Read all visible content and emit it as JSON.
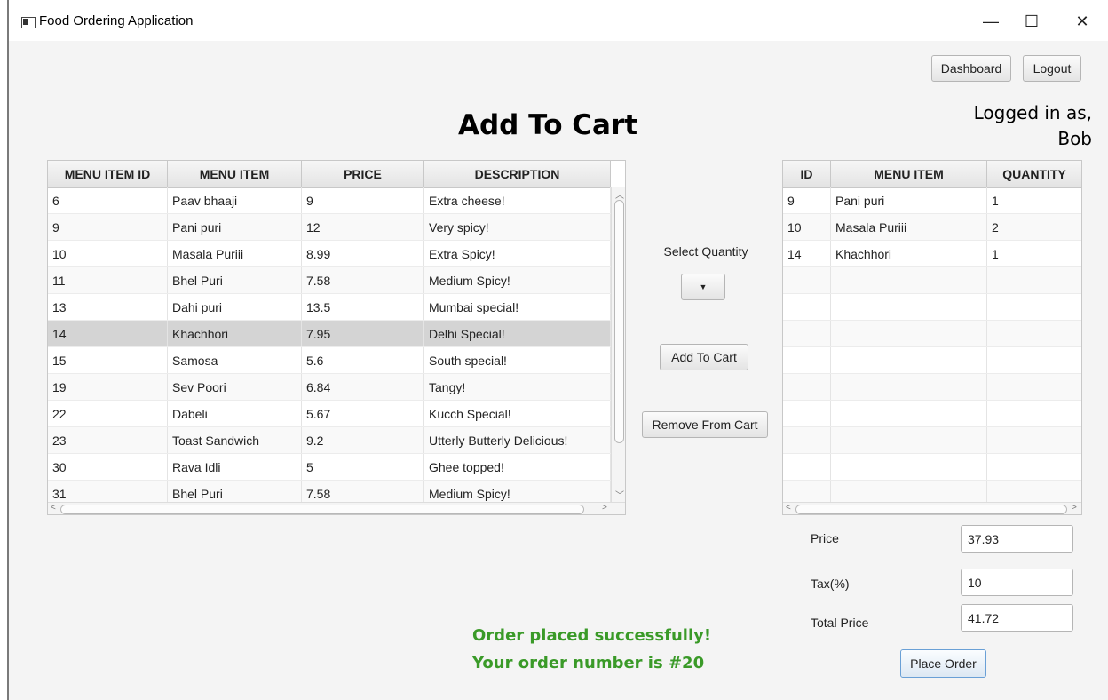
{
  "window": {
    "title": "Food Ordering Application",
    "minimize": "—",
    "maximize": "☐",
    "close": "✕"
  },
  "header": {
    "dashboard_label": "Dashboard",
    "logout_label": "Logout",
    "page_title": "Add To Cart",
    "logged_in_line1": "Logged in as,",
    "logged_in_user": "Bob"
  },
  "menu_table": {
    "columns": [
      "MENU ITEM ID",
      "MENU ITEM",
      "PRICE",
      "DESCRIPTION"
    ],
    "rows": [
      [
        "6",
        "Paav bhaaji",
        "9",
        "Extra cheese!"
      ],
      [
        "9",
        "Pani puri",
        "12",
        "Very spicy!"
      ],
      [
        "10",
        "Masala Puriii",
        "8.99",
        "Extra Spicy!"
      ],
      [
        "11",
        "Bhel Puri",
        "7.58",
        "Medium Spicy!"
      ],
      [
        "13",
        "Dahi puri",
        "13.5",
        "Mumbai special!"
      ],
      [
        "14",
        "Khachhori",
        "7.95",
        "Delhi Special!"
      ],
      [
        "15",
        "Samosa",
        "5.6",
        "South special!"
      ],
      [
        "19",
        "Sev Poori",
        "6.84",
        "Tangy!"
      ],
      [
        "22",
        "Dabeli",
        "5.67",
        "Kucch Special!"
      ],
      [
        "23",
        "Toast Sandwich",
        "9.2",
        "Utterly Butterly Delicious!"
      ],
      [
        "30",
        "Rava Idli",
        "5",
        "Ghee topped!"
      ],
      [
        "31",
        "Bhel Puri",
        "7.58",
        "Medium Spicy!"
      ]
    ],
    "selected_row_index": 5
  },
  "actions": {
    "select_quantity_label": "Select Quantity",
    "add_to_cart_label": "Add To Cart",
    "remove_from_cart_label": "Remove From Cart"
  },
  "cart_table": {
    "columns": [
      "ID",
      "MENU ITEM",
      "QUANTITY"
    ],
    "rows": [
      [
        "9",
        "Pani puri",
        "1"
      ],
      [
        "10",
        "Masala Puriii",
        "2"
      ],
      [
        "14",
        "Khachhori",
        "1"
      ]
    ]
  },
  "totals": {
    "price_label": "Price",
    "price_value": "37.93",
    "tax_label": "Tax(%)",
    "tax_value": "10",
    "total_label": "Total Price",
    "total_value": "41.72",
    "place_order_label": "Place Order"
  },
  "status": {
    "line1": "Order placed successfully!",
    "line2": "Your order number is #20"
  },
  "colors": {
    "success": "#3a9a28",
    "selection": "#d4d4d4"
  }
}
